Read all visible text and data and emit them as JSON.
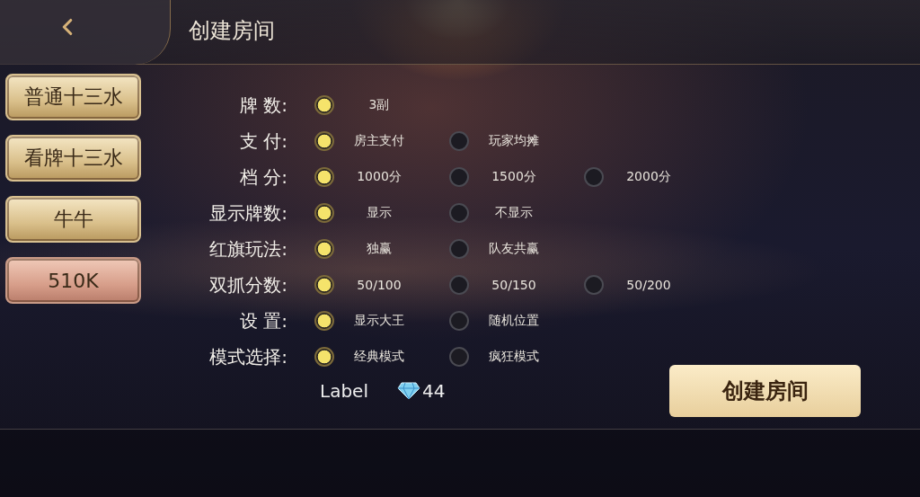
{
  "header": {
    "title": "创建房间"
  },
  "game_tabs": [
    {
      "label": "普通十三水",
      "selected": false
    },
    {
      "label": "看牌十三水",
      "selected": false
    },
    {
      "label": "牛牛",
      "selected": false
    },
    {
      "label": "510K",
      "selected": true
    }
  ],
  "settings": [
    {
      "label": "牌 数:",
      "options": [
        {
          "label": "3副",
          "selected": true
        }
      ]
    },
    {
      "label": "支 付:",
      "options": [
        {
          "label": "房主支付",
          "selected": true
        },
        {
          "label": "玩家均摊",
          "selected": false
        }
      ]
    },
    {
      "label": "档 分:",
      "options": [
        {
          "label": "1000分",
          "selected": true
        },
        {
          "label": "1500分",
          "selected": false
        },
        {
          "label": "2000分",
          "selected": false
        }
      ]
    },
    {
      "label": "显示牌数:",
      "options": [
        {
          "label": "显示",
          "selected": true
        },
        {
          "label": "不显示",
          "selected": false
        }
      ]
    },
    {
      "label": "红旗玩法:",
      "options": [
        {
          "label": "独赢",
          "selected": true
        },
        {
          "label": "队友共赢",
          "selected": false
        }
      ]
    },
    {
      "label": "双抓分数:",
      "options": [
        {
          "label": "50/100",
          "selected": true
        },
        {
          "label": "50/150",
          "selected": false
        },
        {
          "label": "50/200",
          "selected": false
        }
      ]
    },
    {
      "label": "设 置:",
      "options": [
        {
          "label": "显示大王",
          "selected": true
        },
        {
          "label": "随机位置",
          "selected": false
        }
      ]
    },
    {
      "label": "模式选择:",
      "options": [
        {
          "label": "经典模式",
          "selected": true
        },
        {
          "label": "疯狂模式",
          "selected": false
        }
      ]
    }
  ],
  "footer": {
    "label": "Label",
    "diamonds": "44",
    "create_button": "创建房间"
  }
}
